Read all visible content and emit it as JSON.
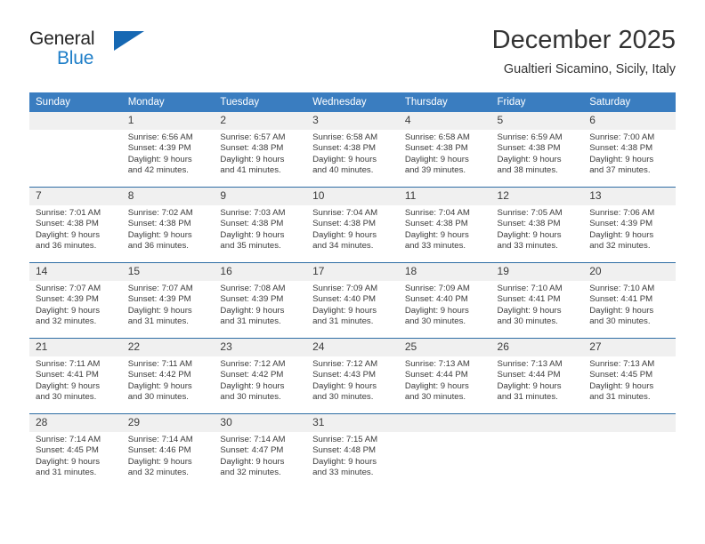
{
  "logo": {
    "word_primary": "General",
    "word_secondary": "Blue",
    "triangle_color": "#1668b3",
    "secondary_color": "#1e7ec8"
  },
  "header": {
    "title": "December 2025",
    "subtitle": "Gualtieri Sicamino, Sicily, Italy"
  },
  "theme": {
    "header_row_bg": "#3a7dc0",
    "grid_line": "#2e6da4",
    "daynum_bg": "#f0f0f0",
    "text": "#3b3b3b"
  },
  "calendar": {
    "weekday_headers": [
      "Sunday",
      "Monday",
      "Tuesday",
      "Wednesday",
      "Thursday",
      "Friday",
      "Saturday"
    ],
    "weeks": [
      [
        {
          "day": "",
          "lines": []
        },
        {
          "day": "1",
          "lines": [
            "Sunrise: 6:56 AM",
            "Sunset: 4:39 PM",
            "Daylight: 9 hours",
            "and 42 minutes."
          ]
        },
        {
          "day": "2",
          "lines": [
            "Sunrise: 6:57 AM",
            "Sunset: 4:38 PM",
            "Daylight: 9 hours",
            "and 41 minutes."
          ]
        },
        {
          "day": "3",
          "lines": [
            "Sunrise: 6:58 AM",
            "Sunset: 4:38 PM",
            "Daylight: 9 hours",
            "and 40 minutes."
          ]
        },
        {
          "day": "4",
          "lines": [
            "Sunrise: 6:58 AM",
            "Sunset: 4:38 PM",
            "Daylight: 9 hours",
            "and 39 minutes."
          ]
        },
        {
          "day": "5",
          "lines": [
            "Sunrise: 6:59 AM",
            "Sunset: 4:38 PM",
            "Daylight: 9 hours",
            "and 38 minutes."
          ]
        },
        {
          "day": "6",
          "lines": [
            "Sunrise: 7:00 AM",
            "Sunset: 4:38 PM",
            "Daylight: 9 hours",
            "and 37 minutes."
          ]
        }
      ],
      [
        {
          "day": "7",
          "lines": [
            "Sunrise: 7:01 AM",
            "Sunset: 4:38 PM",
            "Daylight: 9 hours",
            "and 36 minutes."
          ]
        },
        {
          "day": "8",
          "lines": [
            "Sunrise: 7:02 AM",
            "Sunset: 4:38 PM",
            "Daylight: 9 hours",
            "and 36 minutes."
          ]
        },
        {
          "day": "9",
          "lines": [
            "Sunrise: 7:03 AM",
            "Sunset: 4:38 PM",
            "Daylight: 9 hours",
            "and 35 minutes."
          ]
        },
        {
          "day": "10",
          "lines": [
            "Sunrise: 7:04 AM",
            "Sunset: 4:38 PM",
            "Daylight: 9 hours",
            "and 34 minutes."
          ]
        },
        {
          "day": "11",
          "lines": [
            "Sunrise: 7:04 AM",
            "Sunset: 4:38 PM",
            "Daylight: 9 hours",
            "and 33 minutes."
          ]
        },
        {
          "day": "12",
          "lines": [
            "Sunrise: 7:05 AM",
            "Sunset: 4:38 PM",
            "Daylight: 9 hours",
            "and 33 minutes."
          ]
        },
        {
          "day": "13",
          "lines": [
            "Sunrise: 7:06 AM",
            "Sunset: 4:39 PM",
            "Daylight: 9 hours",
            "and 32 minutes."
          ]
        }
      ],
      [
        {
          "day": "14",
          "lines": [
            "Sunrise: 7:07 AM",
            "Sunset: 4:39 PM",
            "Daylight: 9 hours",
            "and 32 minutes."
          ]
        },
        {
          "day": "15",
          "lines": [
            "Sunrise: 7:07 AM",
            "Sunset: 4:39 PM",
            "Daylight: 9 hours",
            "and 31 minutes."
          ]
        },
        {
          "day": "16",
          "lines": [
            "Sunrise: 7:08 AM",
            "Sunset: 4:39 PM",
            "Daylight: 9 hours",
            "and 31 minutes."
          ]
        },
        {
          "day": "17",
          "lines": [
            "Sunrise: 7:09 AM",
            "Sunset: 4:40 PM",
            "Daylight: 9 hours",
            "and 31 minutes."
          ]
        },
        {
          "day": "18",
          "lines": [
            "Sunrise: 7:09 AM",
            "Sunset: 4:40 PM",
            "Daylight: 9 hours",
            "and 30 minutes."
          ]
        },
        {
          "day": "19",
          "lines": [
            "Sunrise: 7:10 AM",
            "Sunset: 4:41 PM",
            "Daylight: 9 hours",
            "and 30 minutes."
          ]
        },
        {
          "day": "20",
          "lines": [
            "Sunrise: 7:10 AM",
            "Sunset: 4:41 PM",
            "Daylight: 9 hours",
            "and 30 minutes."
          ]
        }
      ],
      [
        {
          "day": "21",
          "lines": [
            "Sunrise: 7:11 AM",
            "Sunset: 4:41 PM",
            "Daylight: 9 hours",
            "and 30 minutes."
          ]
        },
        {
          "day": "22",
          "lines": [
            "Sunrise: 7:11 AM",
            "Sunset: 4:42 PM",
            "Daylight: 9 hours",
            "and 30 minutes."
          ]
        },
        {
          "day": "23",
          "lines": [
            "Sunrise: 7:12 AM",
            "Sunset: 4:42 PM",
            "Daylight: 9 hours",
            "and 30 minutes."
          ]
        },
        {
          "day": "24",
          "lines": [
            "Sunrise: 7:12 AM",
            "Sunset: 4:43 PM",
            "Daylight: 9 hours",
            "and 30 minutes."
          ]
        },
        {
          "day": "25",
          "lines": [
            "Sunrise: 7:13 AM",
            "Sunset: 4:44 PM",
            "Daylight: 9 hours",
            "and 30 minutes."
          ]
        },
        {
          "day": "26",
          "lines": [
            "Sunrise: 7:13 AM",
            "Sunset: 4:44 PM",
            "Daylight: 9 hours",
            "and 31 minutes."
          ]
        },
        {
          "day": "27",
          "lines": [
            "Sunrise: 7:13 AM",
            "Sunset: 4:45 PM",
            "Daylight: 9 hours",
            "and 31 minutes."
          ]
        }
      ],
      [
        {
          "day": "28",
          "lines": [
            "Sunrise: 7:14 AM",
            "Sunset: 4:45 PM",
            "Daylight: 9 hours",
            "and 31 minutes."
          ]
        },
        {
          "day": "29",
          "lines": [
            "Sunrise: 7:14 AM",
            "Sunset: 4:46 PM",
            "Daylight: 9 hours",
            "and 32 minutes."
          ]
        },
        {
          "day": "30",
          "lines": [
            "Sunrise: 7:14 AM",
            "Sunset: 4:47 PM",
            "Daylight: 9 hours",
            "and 32 minutes."
          ]
        },
        {
          "day": "31",
          "lines": [
            "Sunrise: 7:15 AM",
            "Sunset: 4:48 PM",
            "Daylight: 9 hours",
            "and 33 minutes."
          ]
        },
        {
          "day": "",
          "lines": []
        },
        {
          "day": "",
          "lines": []
        },
        {
          "day": "",
          "lines": []
        }
      ]
    ]
  }
}
